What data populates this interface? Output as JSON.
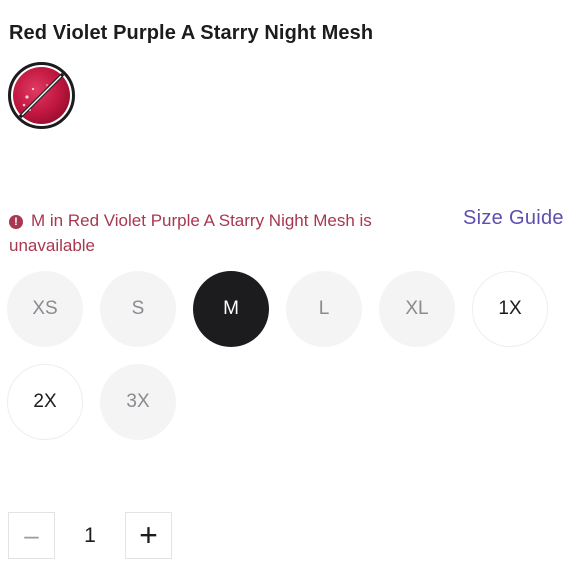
{
  "product": {
    "title": "Red Violet Purple A Starry Night Mesh"
  },
  "swatch": {
    "color": "#c0163f",
    "unavailable": true,
    "icon": "red-violet-purple-starry-night-mesh-swatch"
  },
  "availability": {
    "error_icon": "!",
    "message": "M in Red Violet Purple A Starry Night Mesh is unavailable"
  },
  "size_guide": {
    "label": "Size Guide"
  },
  "sizes": [
    {
      "label": "XS",
      "state": "unavailable"
    },
    {
      "label": "S",
      "state": "unavailable"
    },
    {
      "label": "M",
      "state": "selected"
    },
    {
      "label": "L",
      "state": "unavailable"
    },
    {
      "label": "XL",
      "state": "unavailable"
    },
    {
      "label": "1X",
      "state": "available"
    },
    {
      "label": "2X",
      "state": "available"
    },
    {
      "label": "3X",
      "state": "unavailable"
    }
  ],
  "quantity": {
    "minus_label": "–",
    "value": "1",
    "plus_label": "+"
  },
  "colors": {
    "error": "#a8374f",
    "link": "#5c4fb0",
    "selected": "#1c1c1e"
  }
}
